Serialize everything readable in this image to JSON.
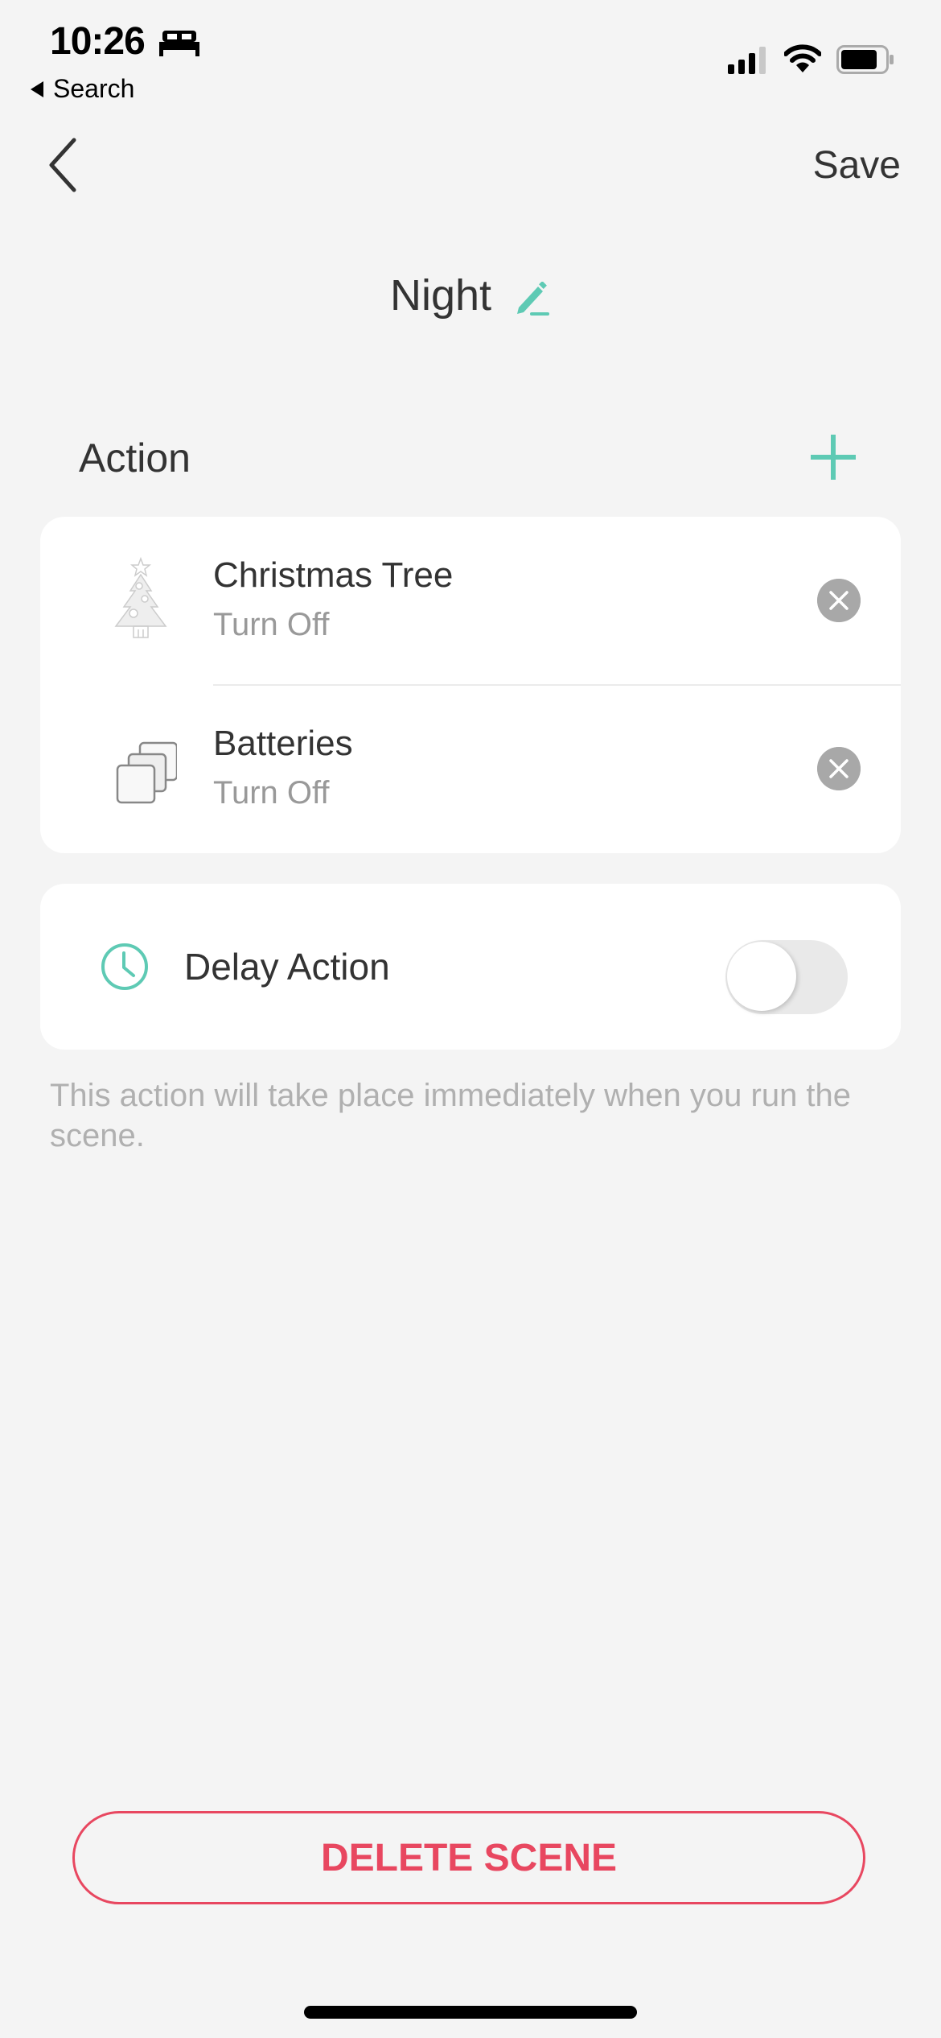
{
  "status_bar": {
    "time": "10:26",
    "back_app": "Search"
  },
  "nav": {
    "save_label": "Save"
  },
  "scene": {
    "title": "Night"
  },
  "action_section": {
    "label": "Action",
    "items": [
      {
        "name": "Christmas Tree",
        "action": "Turn Off",
        "icon": "christmas-tree-icon"
      },
      {
        "name": "Batteries",
        "action": "Turn Off",
        "icon": "stacked-devices-icon"
      }
    ]
  },
  "delay": {
    "label": "Delay Action",
    "enabled": false,
    "note": "This action will take place immediately when you run the scene."
  },
  "delete_label": "DELETE SCENE",
  "colors": {
    "accent": "#5ecab4",
    "danger": "#e84760",
    "background": "#f4f4f4"
  }
}
